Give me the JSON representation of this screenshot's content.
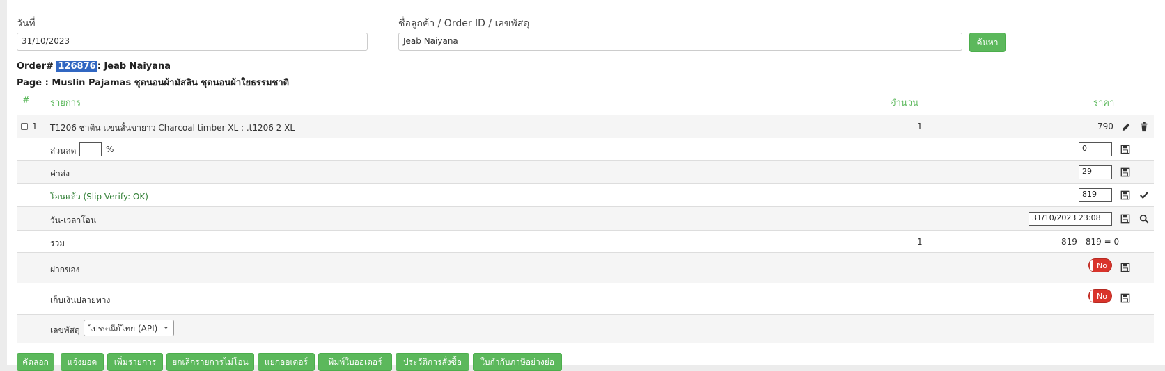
{
  "search": {
    "date_label": "วันที่",
    "date_value": "31/10/2023",
    "query_label": "ชื่อลูกค้า / Order ID / เลขพัสดุ",
    "query_value": "Jeab Naiyana",
    "search_button": "ค้นหา"
  },
  "order": {
    "prefix": "Order#",
    "id": "126876",
    "customer": ": Jeab Naiyana",
    "page_line": "Page : Muslin Pajamas ชุดนอนผ้ามัสลิน ชุดนอนผ้าใยธรรมชาติ"
  },
  "table": {
    "headers": {
      "num": "#",
      "item": "รายการ",
      "qty": "จำนวน",
      "price": "ราคา"
    },
    "item": {
      "index": "1",
      "name": "T1206 ชาติน แขนสั้นขายาว Charcoal timber XL : .t1206 2 XL",
      "qty": "1",
      "price": "790"
    },
    "discount": {
      "label": "ส่วนลด",
      "percent_value": "",
      "percent_sign": "%",
      "value": "0"
    },
    "shipping": {
      "label": "ค่าส่ง",
      "value": "29"
    },
    "paid": {
      "label": "โอนแล้ว (Slip Verify: OK)",
      "value": "819"
    },
    "transfer_time": {
      "label": "วัน-เวลาโอน",
      "value": "31/10/2023 23:08"
    },
    "total": {
      "label": "รวม",
      "qty": "1",
      "value": "819 - 819 = 0"
    },
    "deposit": {
      "label": "ฝากของ",
      "toggle": "No"
    },
    "cod": {
      "label": "เก็บเงินปลายทาง",
      "toggle": "No"
    },
    "tracking": {
      "label": "เลขพัสดุ",
      "carrier": "ไปรษณีย์ไทย (API)"
    }
  },
  "actions": [
    "คัดลอก",
    "แจ้งยอด",
    "เพิ่มรายการ",
    "ยกเลิกรายการไม่โอน",
    "แยกออเดอร์",
    "พิมพ์ใบออเดอร์",
    "ประวัติการสั่งซื้อ",
    "ใบกำกับภาษีอย่างย่อ"
  ],
  "colors": {
    "accent": "#5cb85c",
    "toggle_off": "#d9342b",
    "highlight": "#3167c2"
  }
}
